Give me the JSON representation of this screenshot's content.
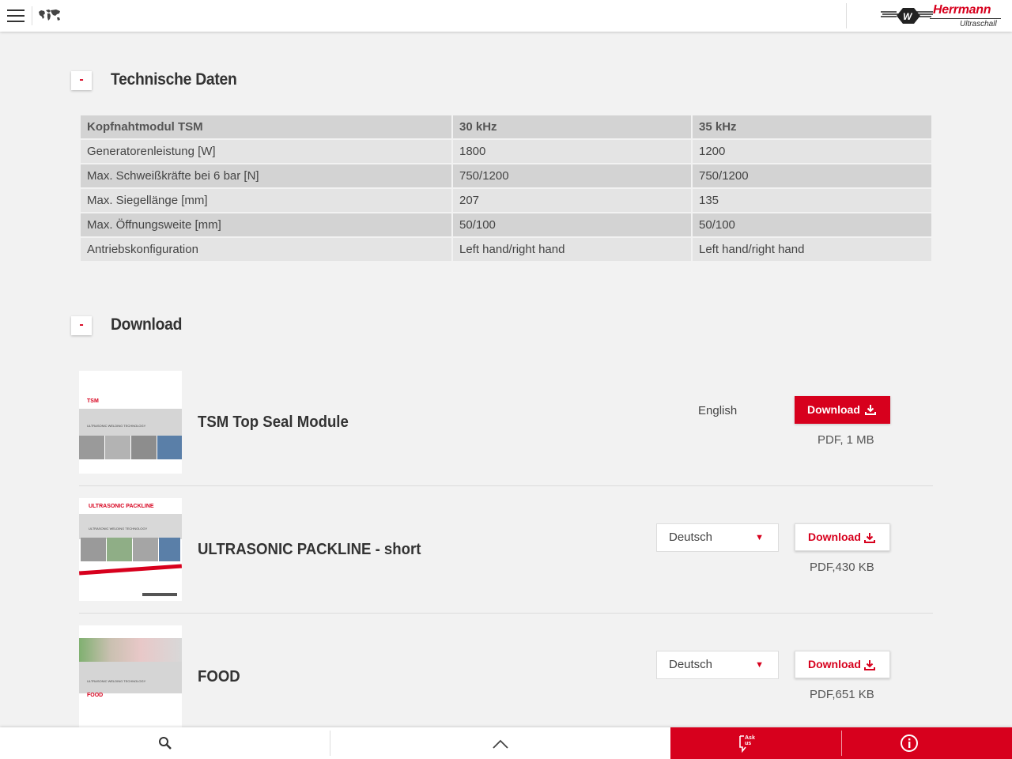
{
  "header": {
    "brand": "Herrmann",
    "brand_sub": "Ultraschall",
    "logo_mark": "W"
  },
  "technical": {
    "toggle": "-",
    "title": "Technische Daten",
    "columns": [
      "Kopfnahtmodul TSM",
      "30 kHz",
      "35 kHz"
    ],
    "rows": [
      [
        "Generatorenleistung [W]",
        "1800",
        "1200"
      ],
      [
        "Max. Schweißkräfte bei 6 bar [N]",
        "750/1200",
        "750/1200"
      ],
      [
        "Max. Siegellänge [mm]",
        "207",
        "135"
      ],
      [
        "Max. Öffnungsweite [mm]",
        "50/100",
        "50/100"
      ],
      [
        "Antriebskonfiguration",
        "Left hand/right hand",
        "Left hand/right hand"
      ]
    ]
  },
  "download": {
    "toggle": "-",
    "title": "Download",
    "button_label": "Download",
    "items": [
      {
        "title": "TSM Top Seal Module",
        "language": "English",
        "file": "PDF, 1 MB",
        "thumb_label": "TSM",
        "thumb_sub": "ULTRASONIC WELDING TECHNOLOGY"
      },
      {
        "title": "ULTRASONIC PACKLINE - short",
        "language": "Deutsch",
        "file": "PDF,430 KB",
        "thumb_label": "ULTRASONIC PACKLINE",
        "thumb_sub": "ULTRASONIC WELDING TECHNOLOGY"
      },
      {
        "title": "FOOD",
        "language": "Deutsch",
        "file": "PDF,651 KB",
        "thumb_label": "FOOD",
        "thumb_sub": "ULTRASONIC WELDING TECHNOLOGY"
      }
    ]
  },
  "footer": {
    "ask_label": "Ask us",
    "icons": [
      "search-icon",
      "chevron-up-icon",
      "ask-us-icon",
      "info-icon"
    ]
  },
  "colors": {
    "accent": "#d7001d",
    "background": "#f2f2f2"
  }
}
